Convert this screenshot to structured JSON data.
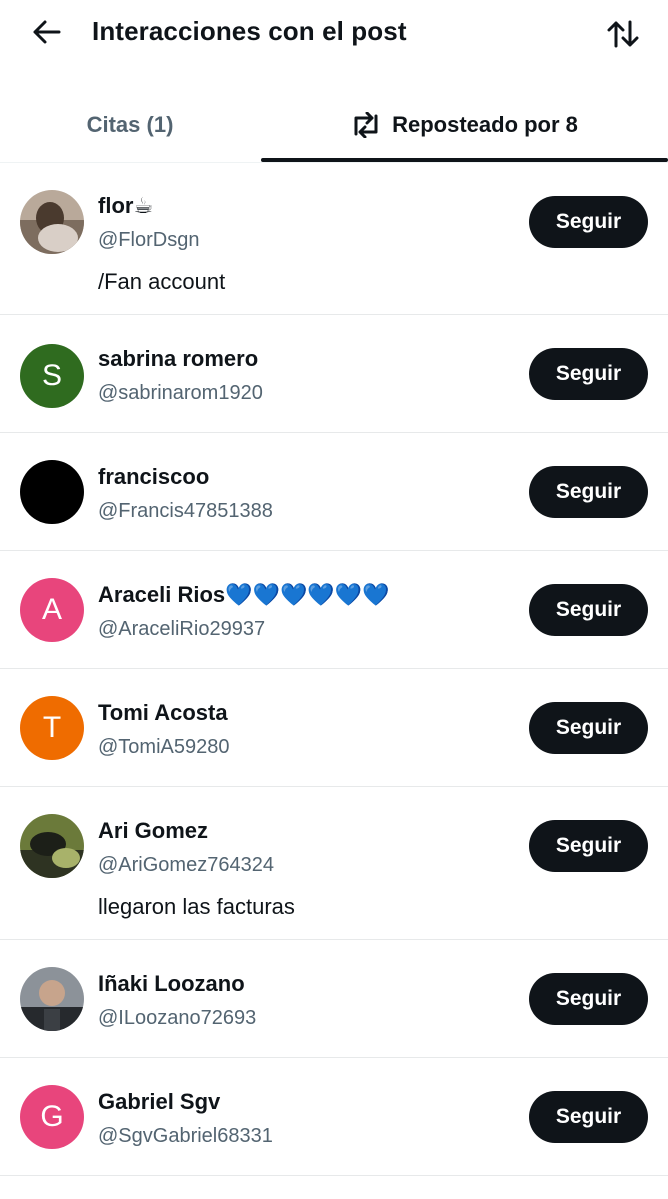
{
  "header": {
    "title": "Interacciones con el post",
    "back_icon": "arrow-left-icon",
    "sort_icon": "sort-arrows-icon"
  },
  "tabs": [
    {
      "label": "Citas (1)",
      "active": false
    },
    {
      "label": "Reposteado por 8",
      "active": true,
      "icon": "repost-icon"
    }
  ],
  "users": [
    {
      "name": "flor☕",
      "handle": "@FlorDsgn",
      "bio": "/Fan account",
      "avatar": {
        "type": "photo",
        "color": "#8a7a6e"
      },
      "follow_label": "Seguir"
    },
    {
      "name": "sabrina romero",
      "handle": "@sabrinarom1920",
      "bio": "",
      "avatar": {
        "type": "letter",
        "letter": "S",
        "color": "#2f6b1f"
      },
      "follow_label": "Seguir"
    },
    {
      "name": "franciscoo",
      "handle": "@Francis47851388",
      "bio": "",
      "avatar": {
        "type": "solid",
        "color": "#000000"
      },
      "follow_label": "Seguir"
    },
    {
      "name": "Araceli Rios💙💙💙💙💙💙",
      "handle": "@AraceliRio29937",
      "bio": "",
      "avatar": {
        "type": "letter",
        "letter": "A",
        "color": "#e8457c"
      },
      "follow_label": "Seguir"
    },
    {
      "name": "Tomi Acosta",
      "handle": "@TomiA59280",
      "bio": "",
      "avatar": {
        "type": "letter",
        "letter": "T",
        "color": "#ef6c00"
      },
      "follow_label": "Seguir"
    },
    {
      "name": "Ari Gomez",
      "handle": "@AriGomez764324",
      "bio": "llegaron las facturas",
      "avatar": {
        "type": "photo",
        "color": "#3c4a2a"
      },
      "follow_label": "Seguir"
    },
    {
      "name": "Iñaki Loozano",
      "handle": "@ILoozano72693",
      "bio": "",
      "avatar": {
        "type": "photo",
        "color": "#555b63"
      },
      "follow_label": "Seguir"
    },
    {
      "name": "Gabriel Sgv",
      "handle": "@SgvGabriel68331",
      "bio": "",
      "avatar": {
        "type": "letter",
        "letter": "G",
        "color": "#e8457c"
      },
      "follow_label": "Seguir"
    }
  ]
}
